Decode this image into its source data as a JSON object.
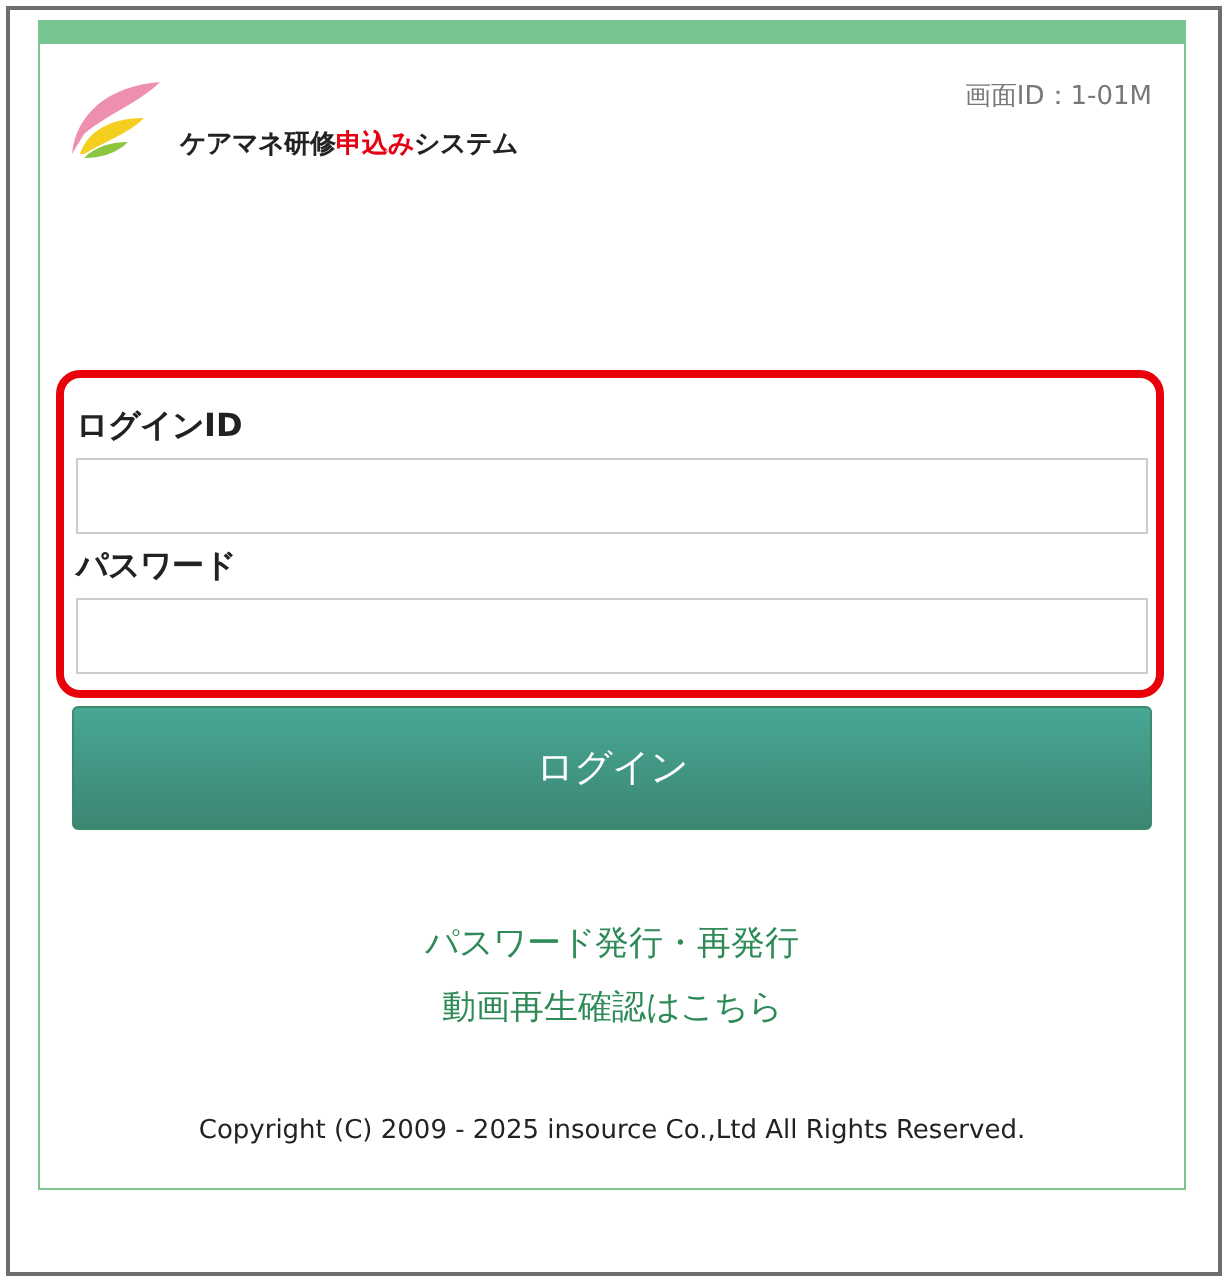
{
  "header": {
    "title": [
      {
        "text": "ケアマネ研修",
        "highlight": false
      },
      {
        "text": "申込み",
        "highlight": true
      },
      {
        "text": "システム",
        "highlight": false
      }
    ],
    "screen_id": "画面ID：1-01M"
  },
  "form": {
    "fields": [
      {
        "label": "ログインID"
      },
      {
        "label": "パスワード"
      }
    ]
  },
  "login_button": "ログイン",
  "links": [
    "パスワード発行・再発行",
    "動画再生確認はこちら"
  ],
  "footer": "Copyright (C) 2009 - 2025 insource Co.,Ltd All Rights Reserved."
}
